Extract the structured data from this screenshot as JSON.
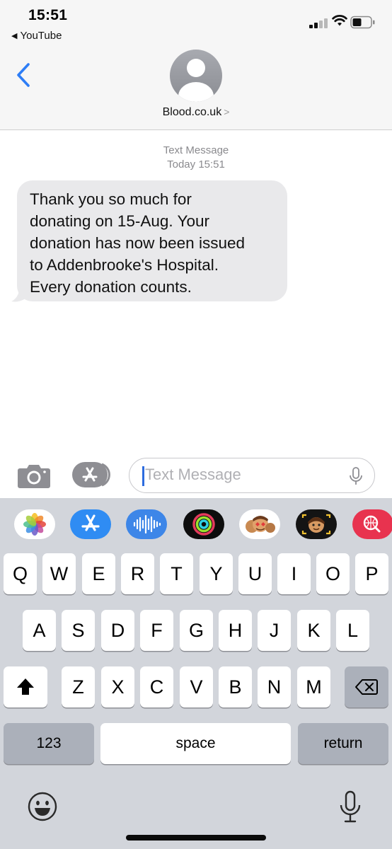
{
  "status_bar": {
    "time": "15:51",
    "back_app_label": "YouTube"
  },
  "header": {
    "contact_name": "Blood.co.uk",
    "contact_chevron": ">"
  },
  "conversation": {
    "service_label": "Text Message",
    "timestamp": "Today 15:51",
    "messages": [
      {
        "direction": "incoming",
        "lines": [
          "Thank you so much for",
          "donating on 15-Aug. Your",
          "donation has now been issued",
          "to Addenbrooke's Hospital.",
          "Every donation counts."
        ]
      }
    ]
  },
  "compose": {
    "placeholder": "Text Message"
  },
  "app_drawer": {
    "apps": [
      {
        "name": "photos-icon"
      },
      {
        "name": "app-store-icon"
      },
      {
        "name": "audio-message-icon"
      },
      {
        "name": "activity-icon"
      },
      {
        "name": "memoji-stickers-icon"
      },
      {
        "name": "animoji-icon"
      },
      {
        "name": "web-images-icon"
      }
    ]
  },
  "keyboard": {
    "row1": [
      "Q",
      "W",
      "E",
      "R",
      "T",
      "Y",
      "U",
      "I",
      "O",
      "P"
    ],
    "row2": [
      "A",
      "S",
      "D",
      "F",
      "G",
      "H",
      "J",
      "K",
      "L"
    ],
    "row3": [
      "Z",
      "X",
      "C",
      "V",
      "B",
      "N",
      "M"
    ],
    "numbers_label": "123",
    "space_label": "space",
    "return_label": "return"
  },
  "colors": {
    "accent": "#2d7df6",
    "bubble_incoming": "#e9e9eb",
    "keyboard_bg": "#d2d5db"
  }
}
